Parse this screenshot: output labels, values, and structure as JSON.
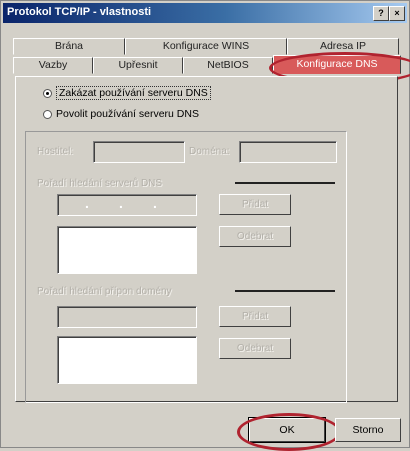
{
  "window": {
    "title": "Protokol TCP/IP - vlastnosti",
    "help_label": "?",
    "close_label": "×"
  },
  "tabs": {
    "row1": [
      "Brána",
      "Konfigurace WINS",
      "Adresa IP"
    ],
    "row2": [
      "Vazby",
      "Upřesnit",
      "NetBIOS",
      "Konfigurace DNS"
    ],
    "active": "Konfigurace DNS"
  },
  "dns": {
    "disable_label": "Zakázat používání serveru DNS",
    "enable_label": "Povolit používání serveru DNS",
    "selected": "disable",
    "host_label": "Hostitel:",
    "domain_label": "Doména:",
    "server_order_label": "Pořadí hledání serverů DNS",
    "suffix_order_label": "Pořadí hledání přípon domény",
    "add_label": "Přidat",
    "remove_label": "Odebrat",
    "ip_separator": "."
  },
  "footer": {
    "ok_label": "OK",
    "cancel_label": "Storno"
  },
  "colors": {
    "active_tab": "#d85a5a",
    "highlight_ring": "#b0232f",
    "titlebar": "#0a246a"
  }
}
